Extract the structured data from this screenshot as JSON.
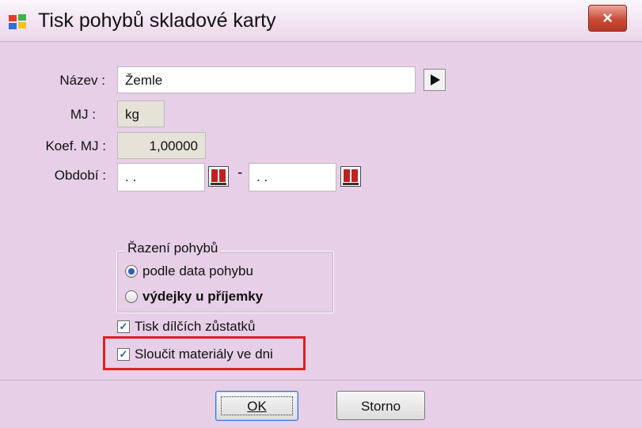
{
  "window": {
    "title": "Tisk pohybů skladové karty",
    "close_label": "×"
  },
  "fields": {
    "nazev": {
      "label": "Název :",
      "value": "Žemle"
    },
    "mj": {
      "label": "MJ :",
      "value": "kg"
    },
    "koef": {
      "label": "Koef. MJ :",
      "value": "1,00000"
    },
    "obdobi": {
      "label": "Období :",
      "from": ". .",
      "to": ". .",
      "separator": "-"
    }
  },
  "sorting": {
    "title": "Řazení pohybů",
    "options": [
      {
        "label": "podle data pohybu",
        "selected": true
      },
      {
        "label": "výdejky u příjemky",
        "selected": false
      }
    ]
  },
  "checkboxes": [
    {
      "label": "Tisk dílčích zůstatků",
      "checked": true
    },
    {
      "label": "Sloučit materiály ve dni",
      "checked": true
    }
  ],
  "buttons": {
    "ok": "OK",
    "storno": "Storno"
  },
  "colors": {
    "background": "#e7cfe7",
    "highlight": "#e0201f",
    "close": "#c94b36"
  },
  "icons": {
    "app": "windows-flag-icon",
    "play": "play-icon",
    "calendar": "calendar-icon",
    "close": "close-icon"
  }
}
